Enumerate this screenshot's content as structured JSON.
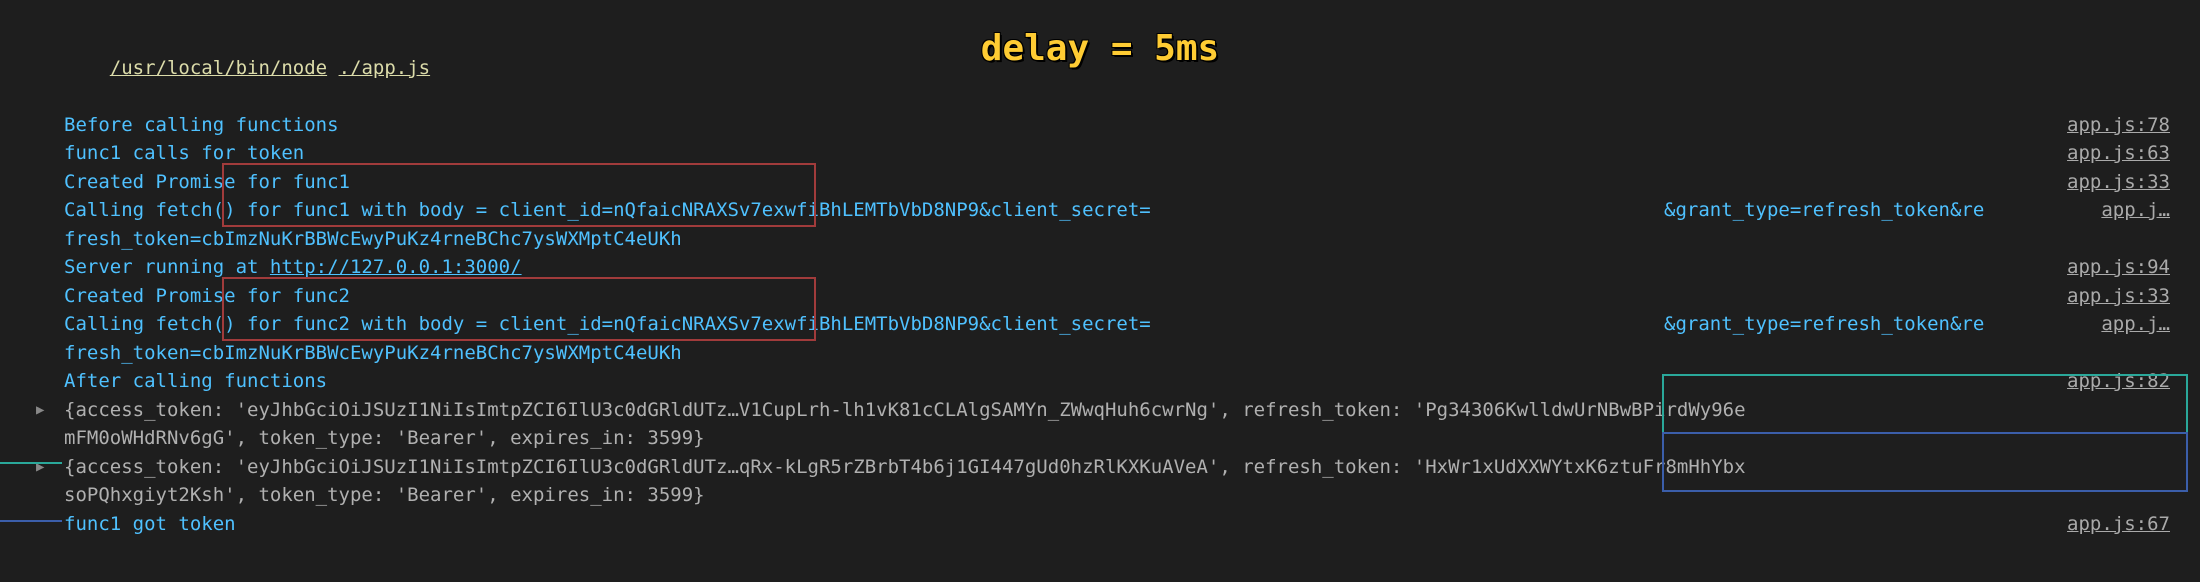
{
  "title_overlay": "delay = 5ms",
  "cmd": {
    "path": "/usr/local/bin/node",
    "arg": "./app.js"
  },
  "server": {
    "prefix": "Server running at ",
    "url": "http://127.0.0.1:3000/"
  },
  "lines": {
    "before": "Before calling functions",
    "func1_calls": "func1 calls for token",
    "created1": "Created Promise for func1",
    "call1_a": "Calling fetch() for func1 with body = client_id=nQfaicNRAXSv7exwfiBhLEMTbVbD8NP9&client_secret=",
    "call1_b": "&grant_type=refresh_token&re",
    "call1_wrap": "fresh_token=cbImzNuKrBBWcEwyPuKz4rneBChc7ysWXMptC4eUKh",
    "created2": "Created Promise for func2",
    "call2_a": "Calling fetch() for func2 with body = client_id=nQfaicNRAXSv7exwfiBhLEMTbVbD8NP9&client_secret=",
    "call2_b": "&grant_type=refresh_token&re",
    "call2_wrap": "fresh_token=cbImzNuKrBBWcEwyPuKz4rneBChc7ysWXMptC4eUKh",
    "after": "After calling functions",
    "obj1_a": "{access_token: 'eyJhbGciOiJSUzI1NiIsImtpZCI6IlU3c0dGRldUTz…V1CupLrh-lh1vK81cCLAlgSAMYn_ZWwqHuh6cwrNg', refresh_token: 'Pg34306KwlldwUrNBwBPirdWy96e",
    "obj1_b": "mFM0oWHdRNv6gG', token_type: 'Bearer', expires_in: 3599}",
    "obj2_a": "{access_token: 'eyJhbGciOiJSUzI1NiIsImtpZCI6IlU3c0dGRldUTz…qRx-kLgR5rZBrbT4b6j1GI447gUd0hzRlKXKuAVeA', refresh_token: 'HxWr1xUdXXWYtxK6ztuFr8mHhYbx",
    "obj2_b": "soPQhxgiyt2Ksh', token_type: 'Bearer', expires_in: 3599}",
    "got_token": "func1 got token"
  },
  "src": {
    "l78": "app.js:78",
    "l63": "app.js:63",
    "l33": "app.js:33",
    "ljdot": "app.j…",
    "l94": "app.js:94",
    "l82": "app.js:82",
    "l67": "app.js:67"
  }
}
